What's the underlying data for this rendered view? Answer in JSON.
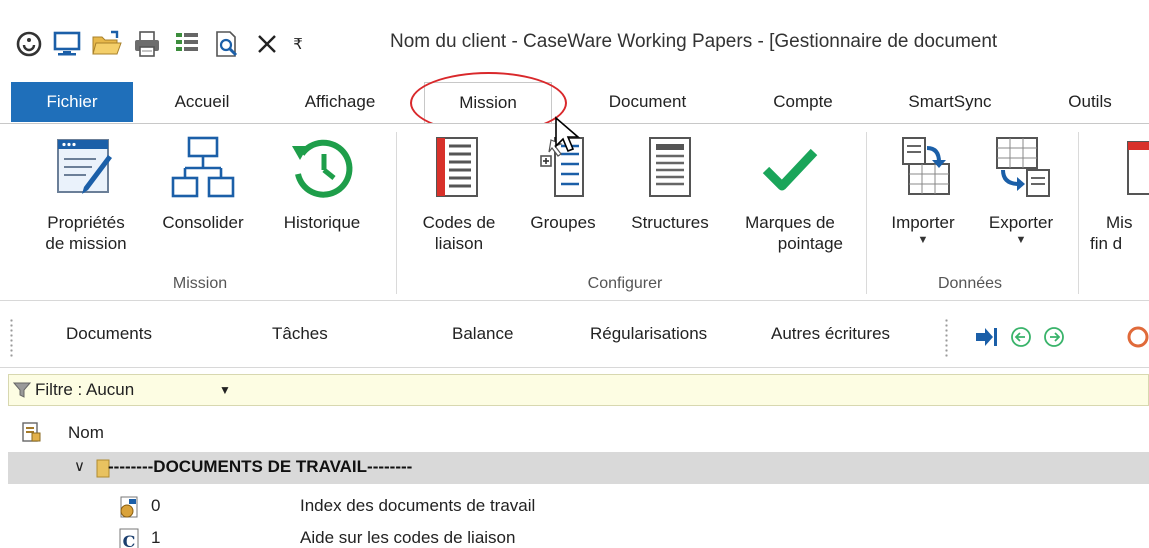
{
  "window": {
    "title": "Nom du client - CaseWare Working Papers - [Gestionnaire de document"
  },
  "quick_access": {
    "icons": [
      "app-logo-icon",
      "monitor-icon",
      "open-folder-icon",
      "print-icon",
      "properties-icon",
      "print-preview-icon",
      "close-x-icon",
      "customize-dropdown-icon"
    ],
    "customize_glyph": "₹"
  },
  "tabs": [
    {
      "label": "Fichier"
    },
    {
      "label": "Accueil"
    },
    {
      "label": "Affichage"
    },
    {
      "label": "Mission"
    },
    {
      "label": "Document"
    },
    {
      "label": "Compte"
    },
    {
      "label": "SmartSync"
    },
    {
      "label": "Outils"
    }
  ],
  "active_tab": "Mission",
  "ribbon": {
    "groups": [
      {
        "label": "Mission"
      },
      {
        "label": "Configurer"
      },
      {
        "label": "Données"
      }
    ],
    "buttons": {
      "proprietes": {
        "line1": "Propriétés",
        "line2": "de mission"
      },
      "consolider": {
        "line1": "Consolider"
      },
      "historique": {
        "line1": "Historique"
      },
      "codes": {
        "line1": "Codes de",
        "line2": "liaison"
      },
      "groupes": {
        "line1": "Groupes"
      },
      "structures": {
        "line1": "Structures"
      },
      "marques": {
        "line1": "Marques de",
        "line2": "pointage"
      },
      "importer": {
        "line1": "Importer",
        "arrow": "▼"
      },
      "exporter": {
        "line1": "Exporter",
        "arrow": "▼"
      },
      "mise": {
        "line1": "Mis",
        "line2": "fin d"
      }
    }
  },
  "toolbar": {
    "documents": "Documents",
    "taches": "Tâches",
    "balance": "Balance",
    "regularisations": "Régularisations",
    "autres": "Autres écritures"
  },
  "filter": {
    "label": "Filtre : Aucun",
    "dropdown": "▼"
  },
  "list": {
    "column_nom": "Nom",
    "group": {
      "expander": "∨",
      "name": "--------DOCUMENTS DE TRAVAIL--------"
    },
    "rows": [
      {
        "num": "0",
        "desc": "Index des documents de travail"
      },
      {
        "num": "1",
        "desc": "Aide sur les codes de liaison"
      }
    ]
  },
  "colors": {
    "file_tab": "#1f6fba",
    "annotation_circle": "#d9282b",
    "historique_green": "#1e9e4a",
    "check_green": "#1aa55a",
    "filter_bg": "#fdfde3",
    "group_row_bg": "#d9d9d9"
  }
}
